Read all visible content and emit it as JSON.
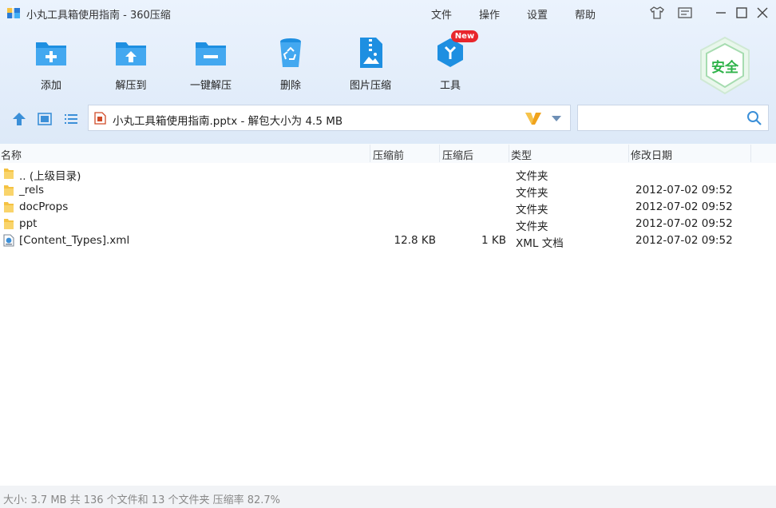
{
  "window": {
    "title": "小丸工具箱使用指南 - 360压缩"
  },
  "menu": [
    "文件",
    "操作",
    "设置",
    "帮助"
  ],
  "toolbar": {
    "add": "添加",
    "extract_to": "解压到",
    "one_click_extract": "一键解压",
    "delete": "删除",
    "image_compress": "图片压缩",
    "tools": "工具",
    "new_badge": "New",
    "safe": "安全"
  },
  "address": {
    "text": "小丸工具箱使用指南.pptx - 解包大小为 4.5 MB",
    "logo_letter": "V"
  },
  "search": {
    "value": "",
    "placeholder": ""
  },
  "columns": {
    "name": "名称",
    "before": "压缩前",
    "after": "压缩后",
    "type": "类型",
    "modified": "修改日期"
  },
  "files": [
    {
      "name": ".. (上级目录)",
      "before": "",
      "after": "",
      "type": "文件夹",
      "date": "",
      "icon": "folder-icon"
    },
    {
      "name": "_rels",
      "before": "",
      "after": "",
      "type": "文件夹",
      "date": "2012-07-02 09:52",
      "icon": "folder-icon"
    },
    {
      "name": "docProps",
      "before": "",
      "after": "",
      "type": "文件夹",
      "date": "2012-07-02 09:52",
      "icon": "folder-icon"
    },
    {
      "name": "ppt",
      "before": "",
      "after": "",
      "type": "文件夹",
      "date": "2012-07-02 09:52",
      "icon": "folder-icon"
    },
    {
      "name": "[Content_Types].xml",
      "before": "12.8 KB",
      "after": "1 KB",
      "type": "XML 文档",
      "date": "2012-07-02 09:52",
      "icon": "xml-file-icon"
    }
  ],
  "status": {
    "text": "大小: 3.7 MB 共 136 个文件和 13 个文件夹 压缩率 82.7%"
  },
  "colors": {
    "accent": "#1e8fe1",
    "accent_light": "#43b0f5",
    "folder": "#f5c242",
    "badge": "#e8262c",
    "safe_green": "#2fb34a"
  }
}
